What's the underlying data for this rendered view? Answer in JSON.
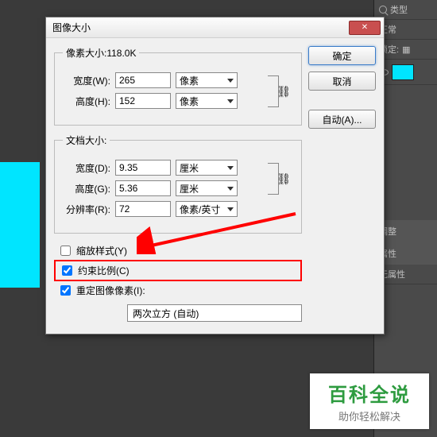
{
  "dialog": {
    "title": "图像大小",
    "pixel_group": {
      "legend": "像素大小:118.0K",
      "width_label": "宽度(W):",
      "width_value": "265",
      "height_label": "高度(H):",
      "height_value": "152",
      "unit": "像素"
    },
    "doc_group": {
      "legend": "文档大小:",
      "width_label": "宽度(D):",
      "width_value": "9.35",
      "height_label": "高度(G):",
      "height_value": "5.36",
      "size_unit": "厘米",
      "res_label": "分辨率(R):",
      "res_value": "72",
      "res_unit": "像素/英寸"
    },
    "checkboxes": {
      "scale_styles": "缩放样式(Y)",
      "constrain": "约束比例(C)",
      "resample": "重定图像像素(I):"
    },
    "resample_method": "两次立方 (自动)",
    "buttons": {
      "ok": "确定",
      "cancel": "取消",
      "auto": "自动(A)..."
    }
  },
  "right_panel": {
    "type_label": "类型",
    "normal_label": "正常",
    "lock_label": "锁定:",
    "adjust_label": "调整",
    "properties_label": "属性",
    "no_properties": "无属性"
  },
  "watermark": {
    "title": "百科全说",
    "subtitle": "助你轻松解决"
  }
}
